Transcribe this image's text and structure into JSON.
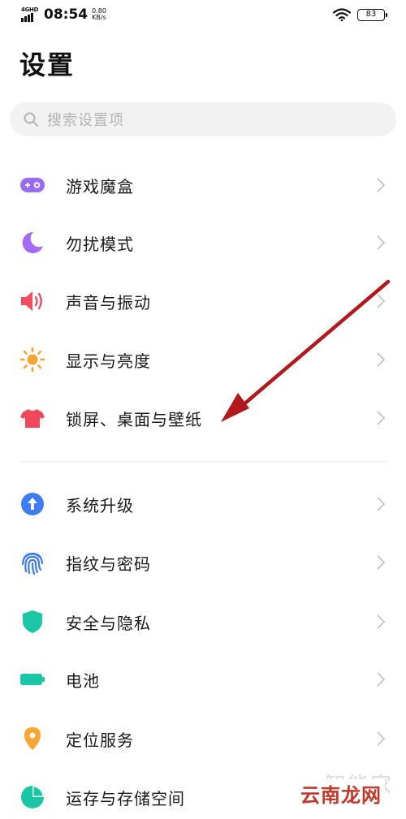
{
  "status_bar": {
    "network": "4GHD",
    "time": "08:54",
    "speed_value": "0.80",
    "speed_unit": "KB/s",
    "battery": "83"
  },
  "page_title": "设置",
  "search": {
    "placeholder": "搜索设置项"
  },
  "settings_group_1": [
    {
      "label": "游戏魔盒",
      "icon": "game-box-icon",
      "color": "#9b6af5"
    },
    {
      "label": "勿扰模式",
      "icon": "moon-icon",
      "color": "#a56af3"
    },
    {
      "label": "声音与振动",
      "icon": "speaker-icon",
      "color": "#f04e5e"
    },
    {
      "label": "显示与亮度",
      "icon": "sun-icon",
      "color": "#f8a531"
    },
    {
      "label": "锁屏、桌面与壁纸",
      "icon": "shirt-icon",
      "color": "#f0475a"
    }
  ],
  "settings_group_2": [
    {
      "label": "系统升级",
      "icon": "upgrade-arrow-icon",
      "color": "#3d7cf2"
    },
    {
      "label": "指纹与密码",
      "icon": "fingerprint-icon",
      "color": "#3d7cf2"
    },
    {
      "label": "安全与隐私",
      "icon": "shield-icon",
      "color": "#19c6a5"
    },
    {
      "label": "电池",
      "icon": "battery-icon",
      "color": "#19c6a5"
    },
    {
      "label": "定位服务",
      "icon": "location-pin-icon",
      "color": "#f8a531"
    },
    {
      "label": "运存与存储空间",
      "icon": "pie-chart-icon",
      "color": "#19c6a5"
    }
  ],
  "annotation_arrow_color": "#b2191c",
  "watermark": {
    "top": "智能家",
    "bottom": "云南龙网"
  }
}
